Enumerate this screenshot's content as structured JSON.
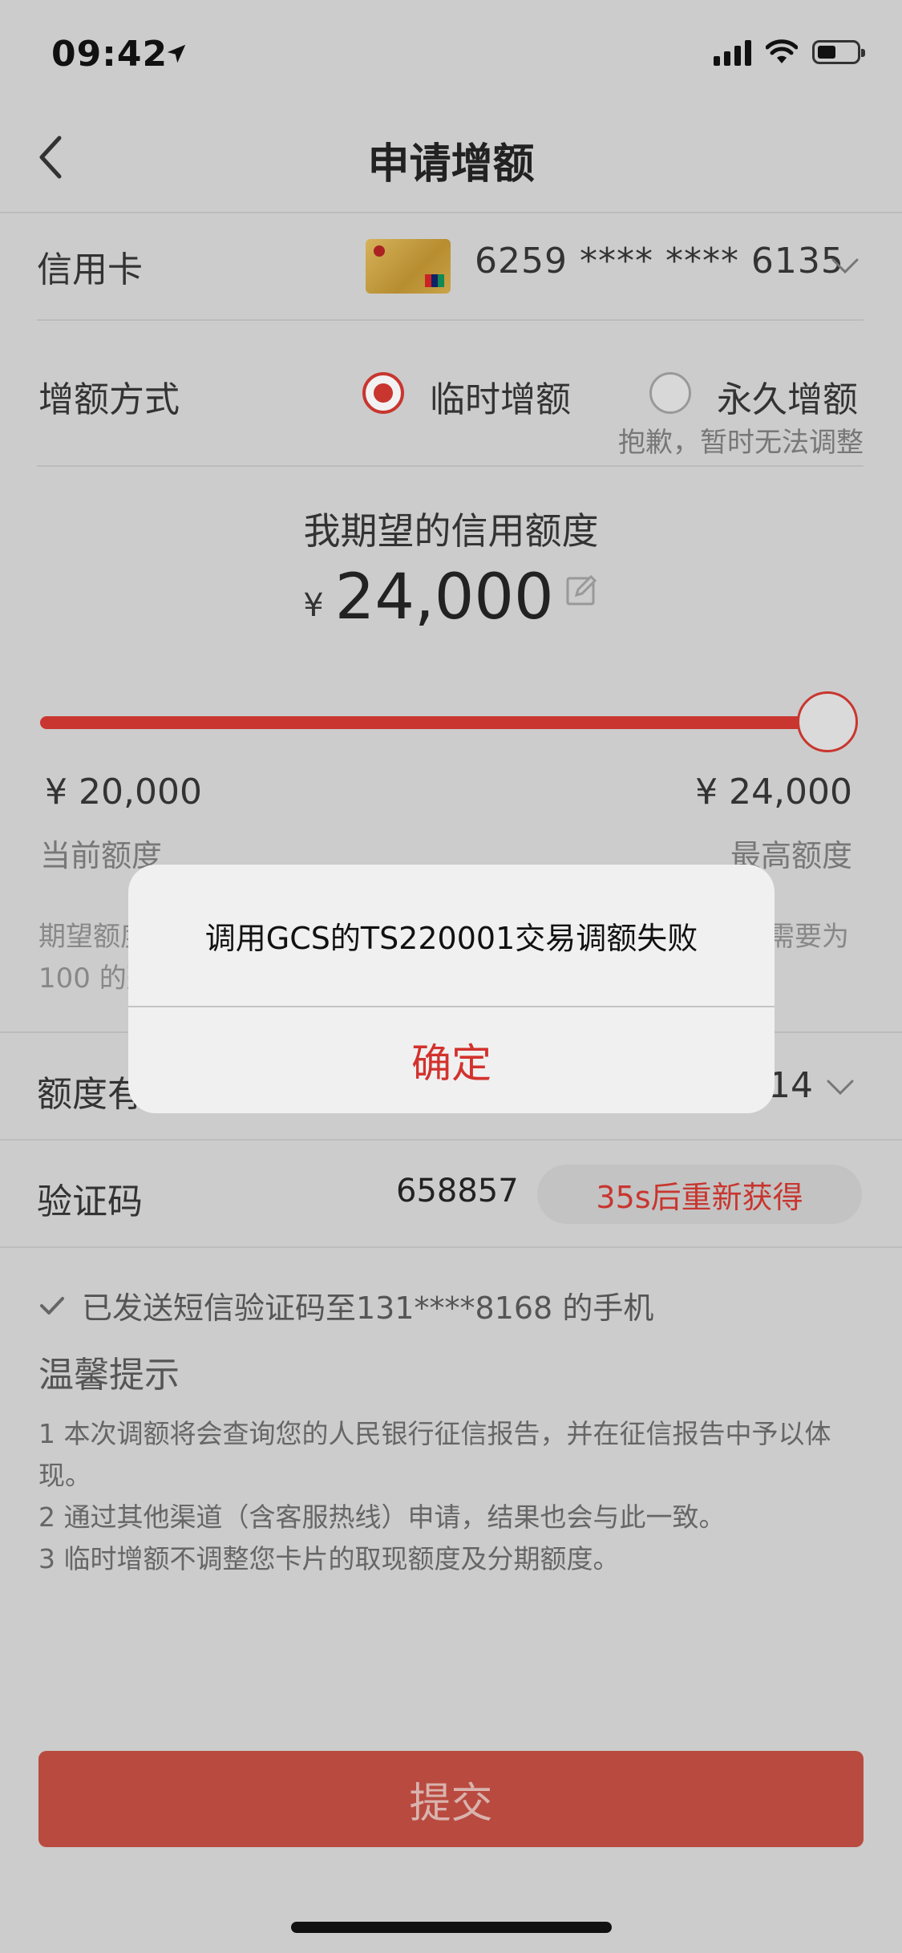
{
  "status_bar": {
    "time": "09:42"
  },
  "nav": {
    "title": "申请增额"
  },
  "card_row": {
    "label": "信用卡",
    "card_number": "6259 **** **** 6135"
  },
  "method_row": {
    "label": "增额方式",
    "option_temporary": "临时增额",
    "option_permanent": "永久增额",
    "selected": "临时增额",
    "permanent_note": "抱歉，暂时无法调整"
  },
  "limit": {
    "title": "我期望的信用额度",
    "currency": "¥",
    "amount": "24,000",
    "slider_fraction": 1.0,
    "min_value": "¥  20,000",
    "min_label": "当前额度",
    "max_value": "¥  24,000",
    "max_label": "最高额度",
    "note_left": "期望额度",
    "note_right": "需要为",
    "note_line2": "100 的整"
  },
  "validity_row": {
    "label_partial": "额度有",
    "value_partial": "14"
  },
  "verify_row": {
    "label": "验证码",
    "code": "658857",
    "resend_label": "35s后重新获得"
  },
  "sms_notice": "已发送短信验证码至131****8168 的手机",
  "tips": {
    "title": "温馨提示",
    "items": [
      "1  本次调额将会查询您的人民银行征信报告，并在征信报告中予以体现。",
      "2  通过其他渠道（含客服热线）申请，结果也会与此一致。",
      "3  临时增额不调整您卡片的取现额度及分期额度。"
    ]
  },
  "submit_label": "提交",
  "dialog": {
    "message": "调用GCS的TS220001交易调额失败",
    "confirm_label": "确定"
  },
  "colors": {
    "accent": "#c8362f",
    "overlay_bg": "#cccccc",
    "dialog_bg": "#f0f0f0"
  }
}
